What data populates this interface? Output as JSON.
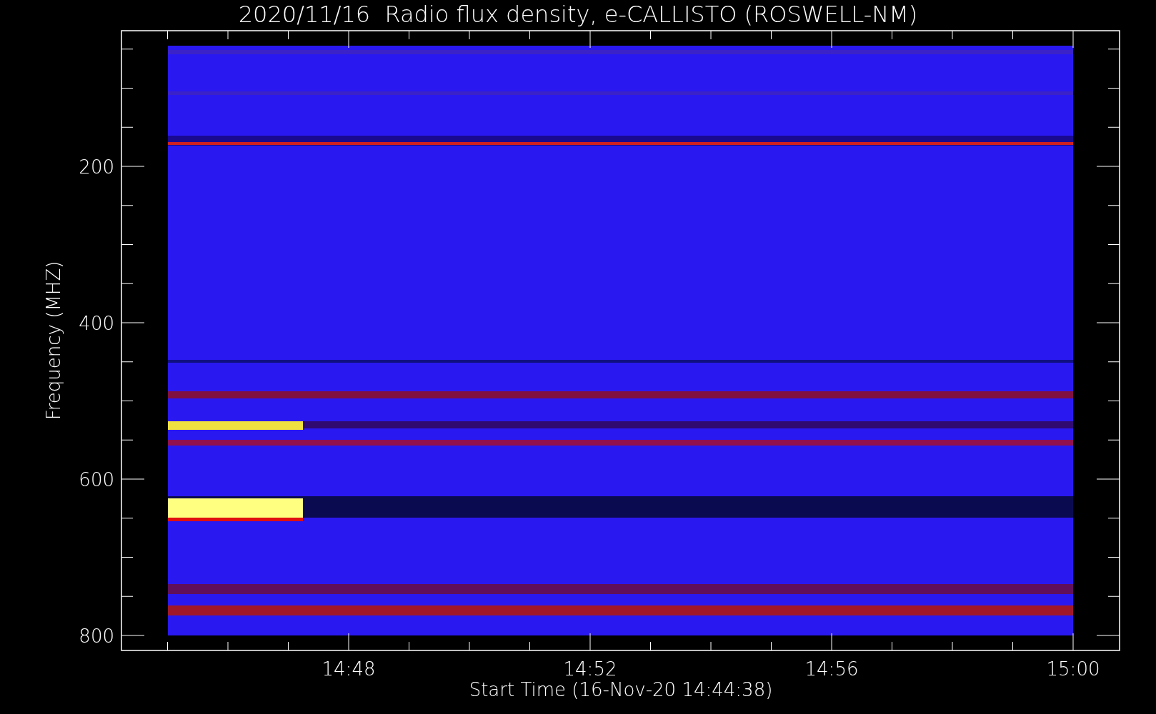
{
  "title": "2020/11/16  Radio flux density, e-CALLISTO (ROSWELL-NM)",
  "y_axis": {
    "label": "Frequency (MHZ)",
    "ticks": [
      "200",
      "400",
      "600",
      "800"
    ]
  },
  "x_axis": {
    "label": "Start Time (16-Nov-20 14:44:38)",
    "ticks": [
      "14:48",
      "14:52",
      "14:56",
      "15:00"
    ]
  }
}
